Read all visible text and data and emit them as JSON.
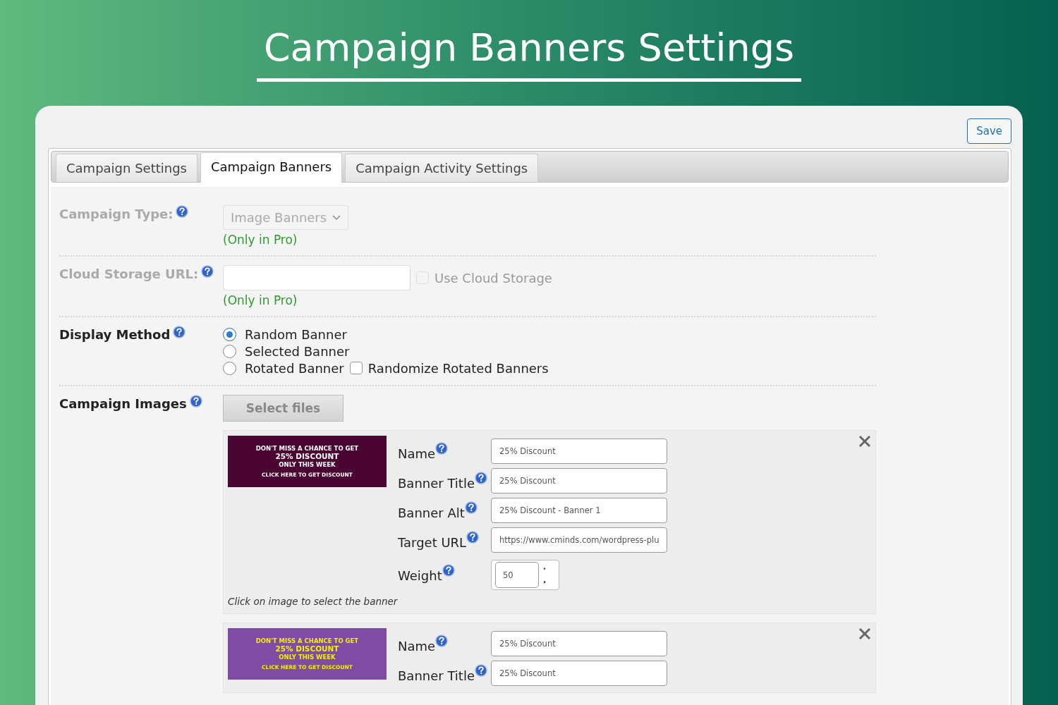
{
  "title": "Campaign Banners Settings",
  "save": "Save",
  "tabs": [
    {
      "label": "Campaign Settings",
      "selected": false
    },
    {
      "label": "Campaign Banners",
      "selected": true
    },
    {
      "label": "Campaign Activity Settings",
      "selected": false
    }
  ],
  "campaign_type": {
    "label": "Campaign Type:",
    "value": "Image Banners",
    "disabled": true,
    "note": "(Only in Pro)"
  },
  "cloud_storage": {
    "label": "Cloud Storage URL:",
    "disabled": true,
    "checkbox_label": "Use Cloud Storage",
    "checked": false,
    "note": "(Only in Pro)"
  },
  "display_method": {
    "label": "Display Method",
    "options": [
      {
        "label": "Random Banner",
        "selected": true
      },
      {
        "label": "Selected Banner",
        "selected": false
      },
      {
        "label": "Rotated Banner",
        "selected": false
      }
    ],
    "randomize": {
      "label": "Randomize Rotated Banners",
      "checked": false
    }
  },
  "campaign_images": {
    "label": "Campaign Images",
    "button": "Select files",
    "banners": [
      {
        "color": "#4a0533",
        "kind": "plain",
        "lines": [
          "DON'T MISS A CHANCE TO GET",
          "25% DISCOUNT",
          "ONLY THIS WEEK",
          "CLICK HERE TO GET DISCOUNT"
        ],
        "fields": [
          {
            "kind": "text",
            "label": "Name",
            "value": "25% Discount"
          },
          {
            "kind": "text",
            "label": "Banner Title",
            "value": "25% Discount"
          },
          {
            "kind": "text",
            "label": "Banner Alt",
            "value": "25% Discount - Banner 1"
          },
          {
            "kind": "text",
            "label": "Target URL",
            "value": "https://www.cminds.com/wordpress-plu"
          },
          {
            "kind": "number",
            "label": "Weight",
            "value": "50"
          }
        ],
        "caption": "Click on image to select the banner"
      },
      {
        "color": "#7e4ca3",
        "kind": "accent",
        "lines": [
          "DON'T MISS A CHANCE TO GET",
          "25% DISCOUNT",
          "ONLY THIS WEEK",
          "CLICK HERE TO GET DISCOUNT"
        ],
        "fields": [
          {
            "kind": "text",
            "label": "Name",
            "value": "25% Discount"
          },
          {
            "kind": "text",
            "label": "Banner Title",
            "value": "25% Discount"
          }
        ]
      }
    ]
  }
}
